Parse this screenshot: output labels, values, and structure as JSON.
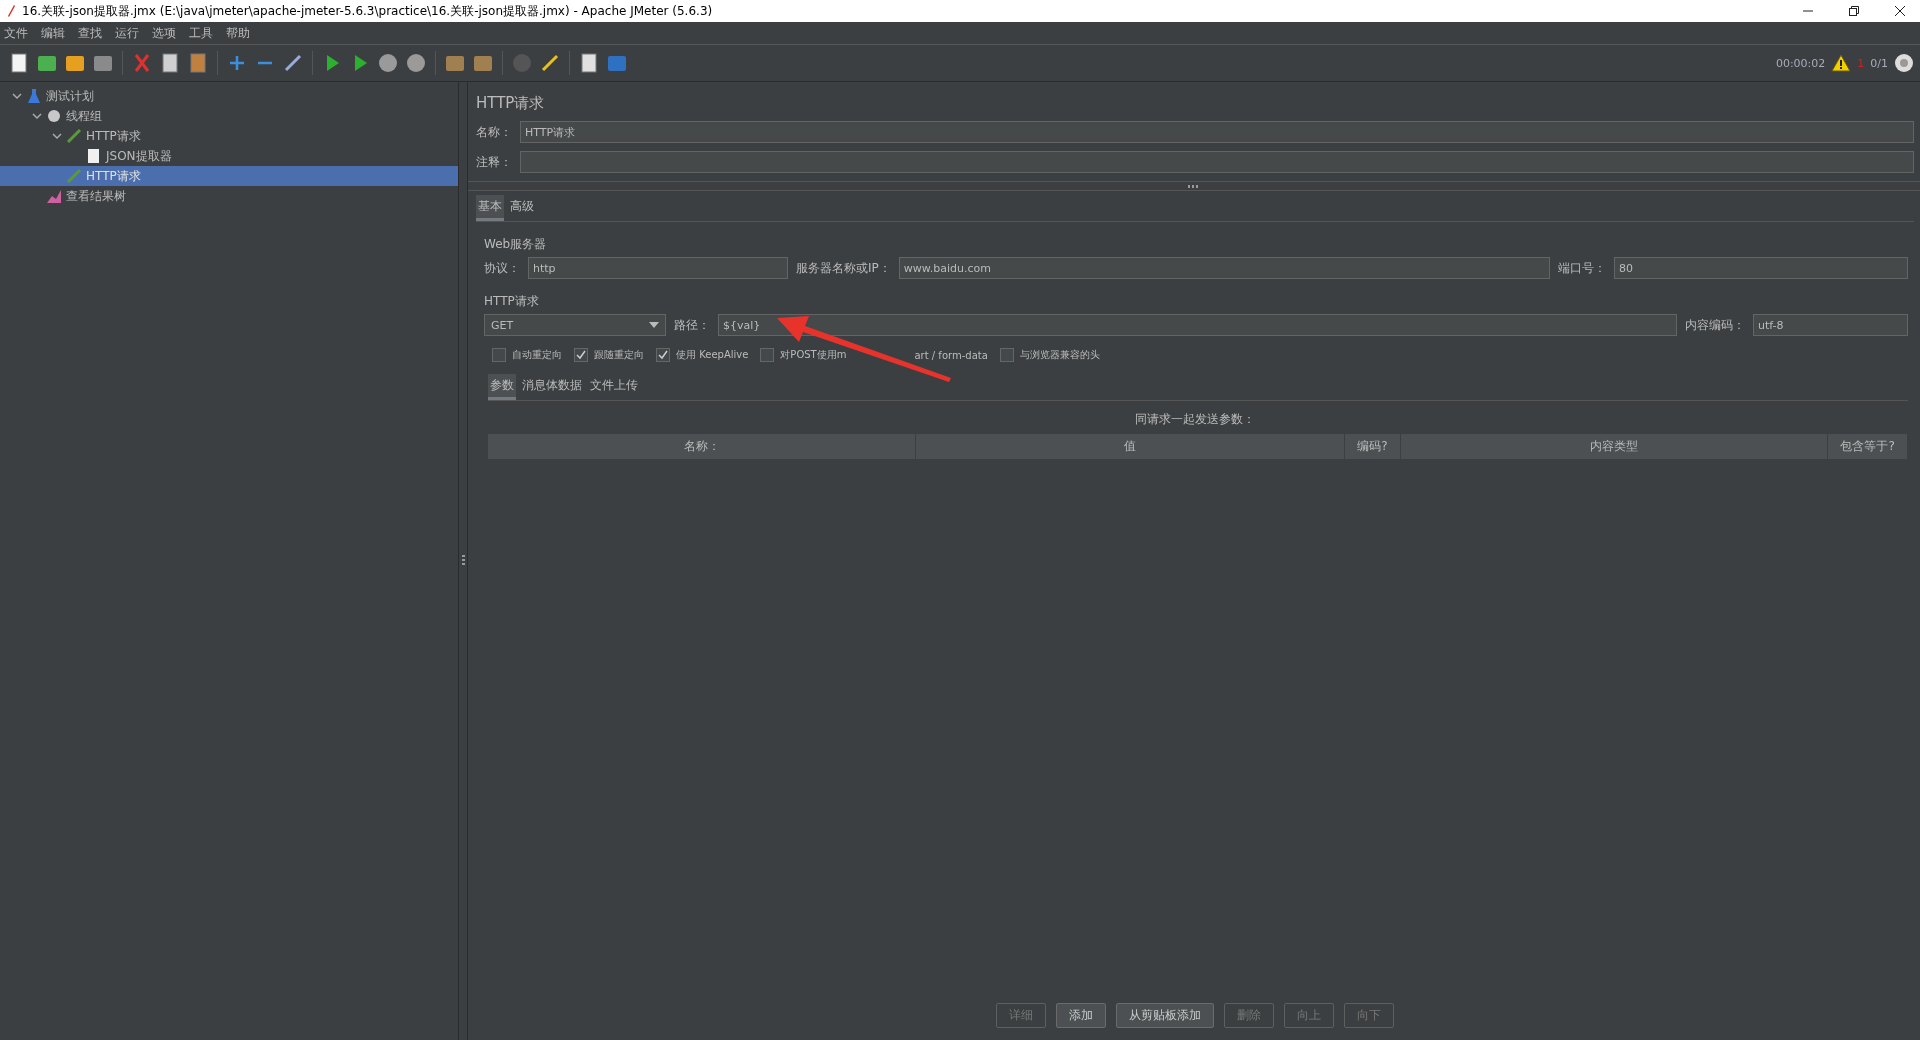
{
  "window": {
    "title": "16.关联-json提取器.jmx (E:\\java\\jmeter\\apache-jmeter-5.6.3\\practice\\16.关联-json提取器.jmx) - Apache JMeter (5.6.3)"
  },
  "menu": [
    "文件",
    "编辑",
    "查找",
    "运行",
    "选项",
    "工具",
    "帮助"
  ],
  "status": {
    "elapsed": "00:00:02",
    "warnings": "1",
    "threads": "0/1"
  },
  "tree": [
    {
      "label": "测试计划",
      "kind": "plan",
      "expanded": true,
      "selected": false,
      "children": [
        {
          "label": "线程组",
          "kind": "group",
          "expanded": true,
          "selected": false,
          "children": [
            {
              "label": "HTTP请求",
              "kind": "sampler",
              "expanded": true,
              "selected": false,
              "children": [
                {
                  "label": "JSON提取器",
                  "kind": "extractor",
                  "selected": false
                }
              ]
            },
            {
              "label": "HTTP请求",
              "kind": "sampler",
              "selected": true
            }
          ]
        },
        {
          "label": "查看结果树",
          "kind": "listener",
          "selected": false
        }
      ]
    }
  ],
  "panel_title": "HTTP请求",
  "name_field": {
    "label": "名称：",
    "value": "HTTP请求"
  },
  "comment_field": {
    "label": "注释："
  },
  "tabs": [
    {
      "label": "基本",
      "selected": true
    },
    {
      "label": "高级",
      "selected": false
    }
  ],
  "web_server": {
    "title": "Web服务器",
    "protocol_label": "协议：",
    "protocol": "http",
    "server_label": "服务器名称或IP：",
    "server": "www.baidu.com",
    "port_label": "端口号：",
    "port": "80"
  },
  "http_request": {
    "title": "HTTP请求",
    "method": "GET",
    "path_label": "路径：",
    "path": "${val}",
    "encoding_label": "内容编码：",
    "encoding": "utf-8"
  },
  "checkboxes": [
    {
      "label": "自动重定向",
      "checked": false
    },
    {
      "label": "跟随重定向",
      "checked": true
    },
    {
      "label": "使用 KeepAlive",
      "checked": true
    },
    {
      "label": "对POST使用m",
      "label_after_arrow": "art / form-data",
      "checked": false
    },
    {
      "label": "与浏览器兼容的头",
      "checked": false
    }
  ],
  "sub_tabs": [
    {
      "label": "参数",
      "selected": true
    },
    {
      "label": "消息体数据",
      "selected": false
    },
    {
      "label": "文件上传",
      "selected": false
    }
  ],
  "params_caption": "同请求一起发送参数：",
  "table": {
    "columns": [
      "名称：",
      "值",
      "编码?",
      "内容类型",
      "包含等于?"
    ]
  },
  "buttons": [
    {
      "label": "详细",
      "disabled": true
    },
    {
      "label": "添加",
      "disabled": false
    },
    {
      "label": "从剪贴板添加",
      "disabled": false
    },
    {
      "label": "删除",
      "disabled": true
    },
    {
      "label": "向上",
      "disabled": true
    },
    {
      "label": "向下",
      "disabled": true
    }
  ]
}
